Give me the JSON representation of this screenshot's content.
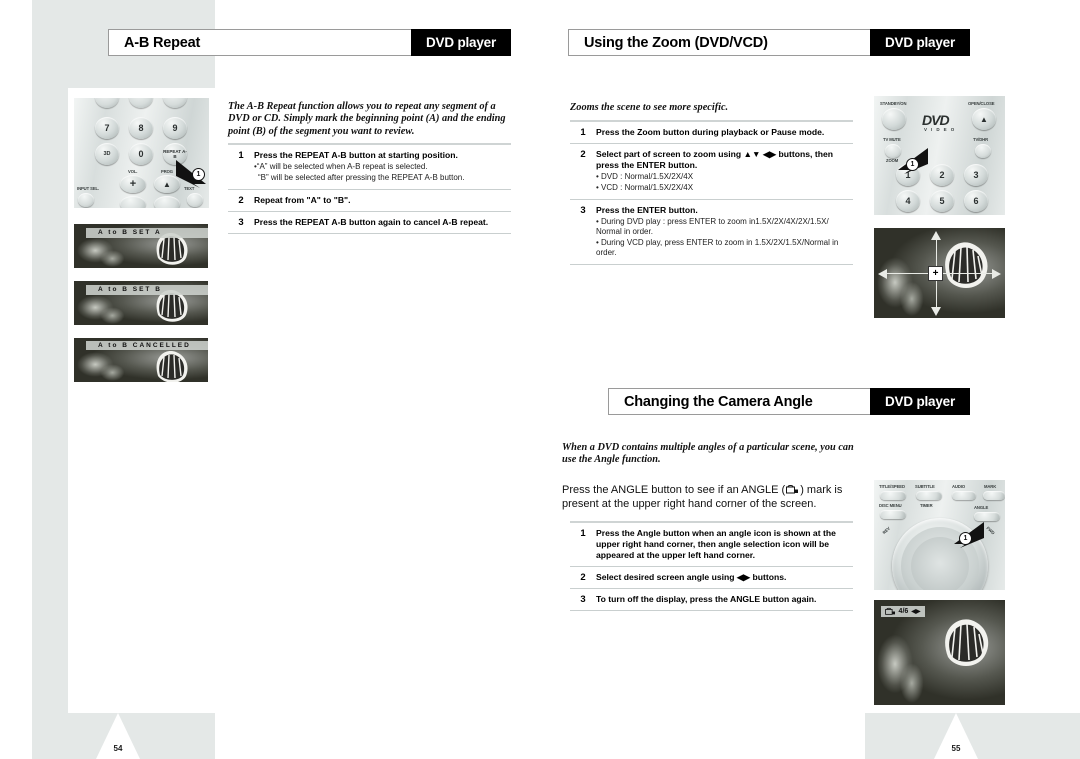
{
  "document": {
    "type": "DVD player instruction manual spread",
    "brand_tag": "DVD player"
  },
  "left_page": {
    "number": "54",
    "header": {
      "title": "A-B Repeat",
      "tag": "DVD player"
    },
    "intro": "The A-B Repeat function allows you to repeat any segment of a DVD or CD. Simply mark the beginning point (A) and the ending point (B) of the segment you want to review.",
    "steps": [
      {
        "num": "1",
        "title": "Press the REPEAT A-B button at starting position.",
        "subs": [
          "•“A” will be selected when A-B repeat is selected.",
          "  “B” will be selected after pressing the REPEAT A-B button."
        ]
      },
      {
        "num": "2",
        "title": "Repeat from \"A\" to \"B\".",
        "subs": []
      },
      {
        "num": "3",
        "title": "Press the REPEAT A-B button again to cancel A-B repeat.",
        "subs": []
      }
    ],
    "remote": {
      "name": "remote-keypad-repeat-ab",
      "keys": [
        "7",
        "8",
        "9",
        "3D",
        "0"
      ],
      "repeat_key": "REPEAT A-B",
      "labels": [
        "VOL.",
        "PROG",
        "INPUT SEL.",
        "TEXT"
      ],
      "callout": "1"
    },
    "screens": [
      {
        "name": "osd-set-a",
        "osd": "A  to  B   SET   A"
      },
      {
        "name": "osd-set-b",
        "osd": "A  to  B   SET   B"
      },
      {
        "name": "osd-cancelled",
        "osd": "A  to  B   CANCELLED"
      }
    ]
  },
  "right_page": {
    "number": "55",
    "zoom_section": {
      "header": {
        "title": "Using the Zoom (DVD/VCD)",
        "tag": "DVD player"
      },
      "intro": "Zooms the scene to see more specific.",
      "steps": [
        {
          "num": "1",
          "title": "Press the Zoom button during playback or Pause mode.",
          "subs": []
        },
        {
          "num": "2",
          "title": "Select part of screen to zoom using ▲▼ ◀▶ buttons, then press the ENTER button.",
          "subs": [
            "• DVD : Normal/1.5X/2X/4X",
            "• VCD : Normal/1.5X/2X/4X"
          ]
        },
        {
          "num": "3",
          "title": "Press the ENTER button.",
          "subs": [
            "• During DVD play : press ENTER to zoom in1.5X/2X/4X/2X/1.5X/ Normal in order.",
            "• During VCD play, press ENTER to zoom in 1.5X/2X/1.5X/Normal in order."
          ]
        }
      ],
      "remote": {
        "name": "remote-top-zoom",
        "top_labels": [
          "STANDBY/ON",
          "OPEN/CLOSE"
        ],
        "logo": "DVD",
        "logo_sub": "V I D E O",
        "mid_labels": [
          "TV MUTE",
          "TV/DHR"
        ],
        "zoom_label": "ZOOM",
        "keys": [
          "1",
          "2",
          "3",
          "4",
          "5",
          "6"
        ],
        "callout": "1"
      },
      "screen": {
        "name": "zoom-target-screen",
        "marker": "+"
      }
    },
    "angle_section": {
      "header": {
        "title": "Changing the Camera Angle",
        "tag": "DVD player"
      },
      "intro": "When a DVD contains multiple angles of a particular scene, you can use the Angle function.",
      "paragraph_before": "Press the ANGLE button to see if an ANGLE (",
      "paragraph_after": ") mark is present at the upper right hand corner of the screen.",
      "steps": [
        {
          "num": "1",
          "title": "Press the Angle button when an angle icon is shown at the upper right hand corner, then angle selection icon will be appeared at the upper left hand corner.",
          "subs": []
        },
        {
          "num": "2",
          "title": "Select desired screen angle using ◀▶ buttons.",
          "subs": []
        },
        {
          "num": "3",
          "title": "To turn off the display, press the ANGLE button again.",
          "subs": []
        }
      ],
      "remote": {
        "name": "remote-angle-jogdial",
        "row1": [
          "TITLE/SPEED",
          "SUBTITLE",
          "AUDIO",
          "MARK"
        ],
        "row2": [
          "DISC MENU",
          "TIMER",
          "ANGLE"
        ],
        "side_labels": [
          "REV",
          "FWD"
        ],
        "callout": "1"
      },
      "screen": {
        "name": "angle-osd-screen",
        "osd_text": "4/6",
        "osd_arrows": "◀▶"
      }
    }
  }
}
